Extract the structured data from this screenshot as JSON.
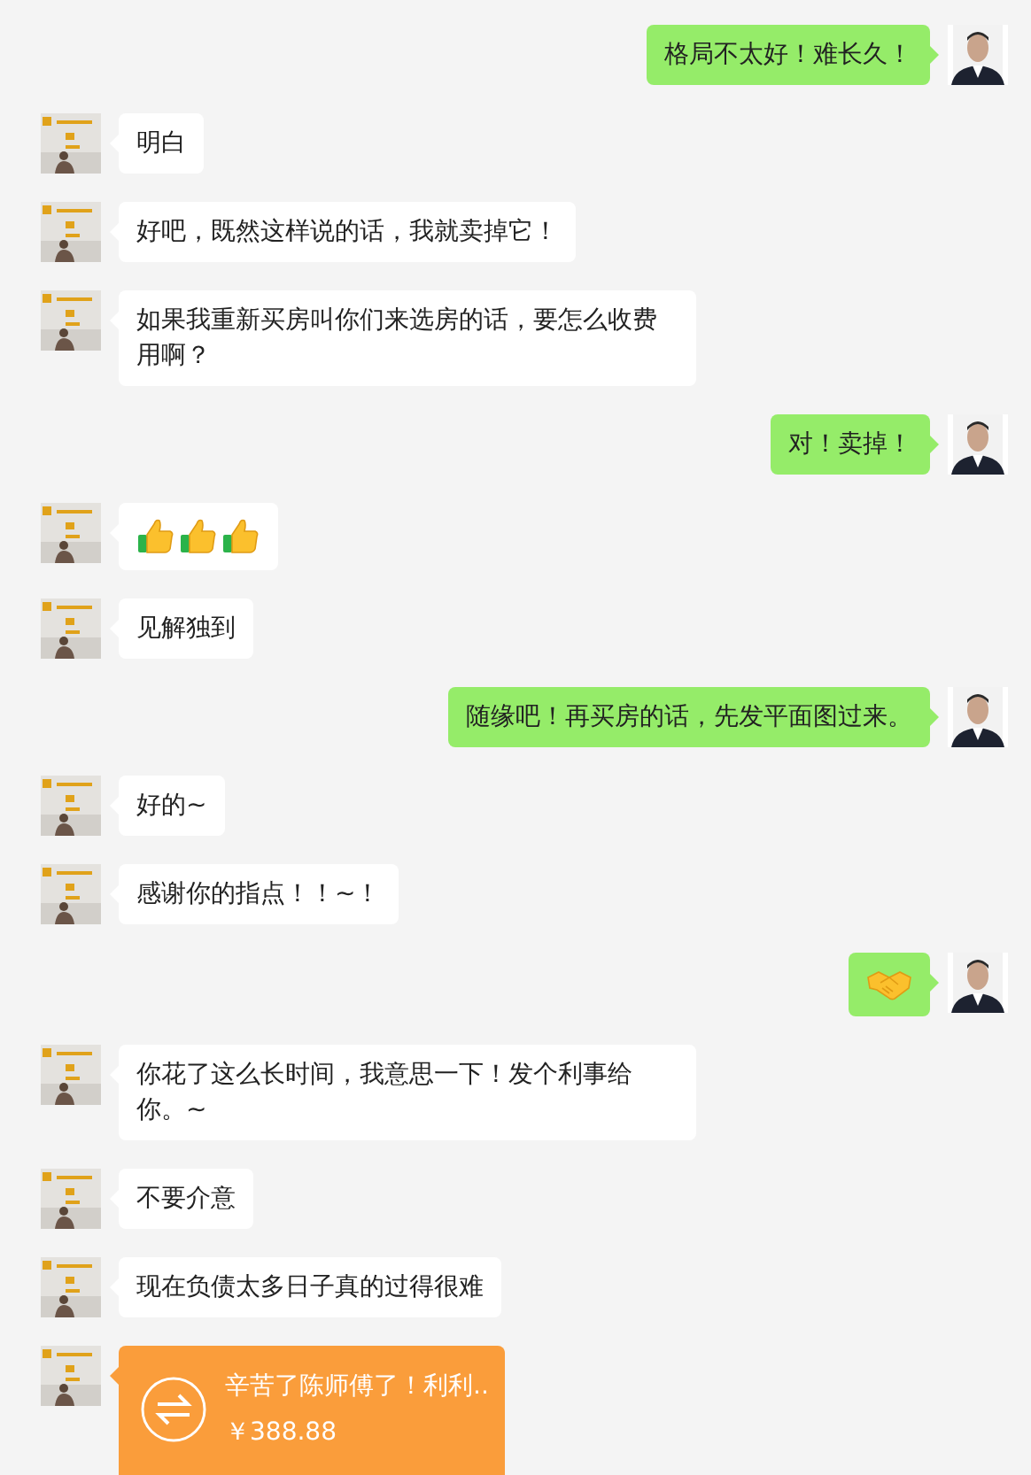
{
  "messages": [
    {
      "kind": "cut"
    },
    {
      "outgoing": true,
      "kind": "text",
      "text": "格局不太好！难长久！"
    },
    {
      "outgoing": false,
      "kind": "text",
      "text": "明白"
    },
    {
      "outgoing": false,
      "kind": "text",
      "text": "好吧，既然这样说的话，我就卖掉它！"
    },
    {
      "outgoing": false,
      "kind": "text",
      "text": "如果我重新买房叫你们来选房的话，要怎么收费用啊？"
    },
    {
      "outgoing": true,
      "kind": "text",
      "text": "对！卖掉！"
    },
    {
      "outgoing": false,
      "kind": "emoji",
      "icons": [
        {
          "kind": "thumbs_up"
        },
        {
          "kind": "thumbs_up"
        },
        {
          "kind": "thumbs_up"
        }
      ]
    },
    {
      "outgoing": false,
      "kind": "text",
      "text": "见解独到"
    },
    {
      "outgoing": true,
      "kind": "text",
      "text": "随缘吧！再买房的话，先发平面图过来。"
    },
    {
      "outgoing": false,
      "kind": "text",
      "text": "好的~"
    },
    {
      "outgoing": false,
      "kind": "text",
      "text": "感谢你的指点！！~！"
    },
    {
      "outgoing": true,
      "kind": "emoji",
      "icons": [
        {
          "kind": "handshake"
        }
      ]
    },
    {
      "outgoing": false,
      "kind": "text",
      "text": "你花了这么长时间，我意思一下！发个利事给你。~"
    },
    {
      "outgoing": false,
      "kind": "text",
      "text": "不要介意"
    },
    {
      "outgoing": false,
      "kind": "text",
      "text": "现在负债太多日子真的过得很难"
    },
    {
      "outgoing": false,
      "kind": "transfer",
      "title": "辛苦了陈师傅了！利利..",
      "amount": "￥388.88"
    }
  ]
}
